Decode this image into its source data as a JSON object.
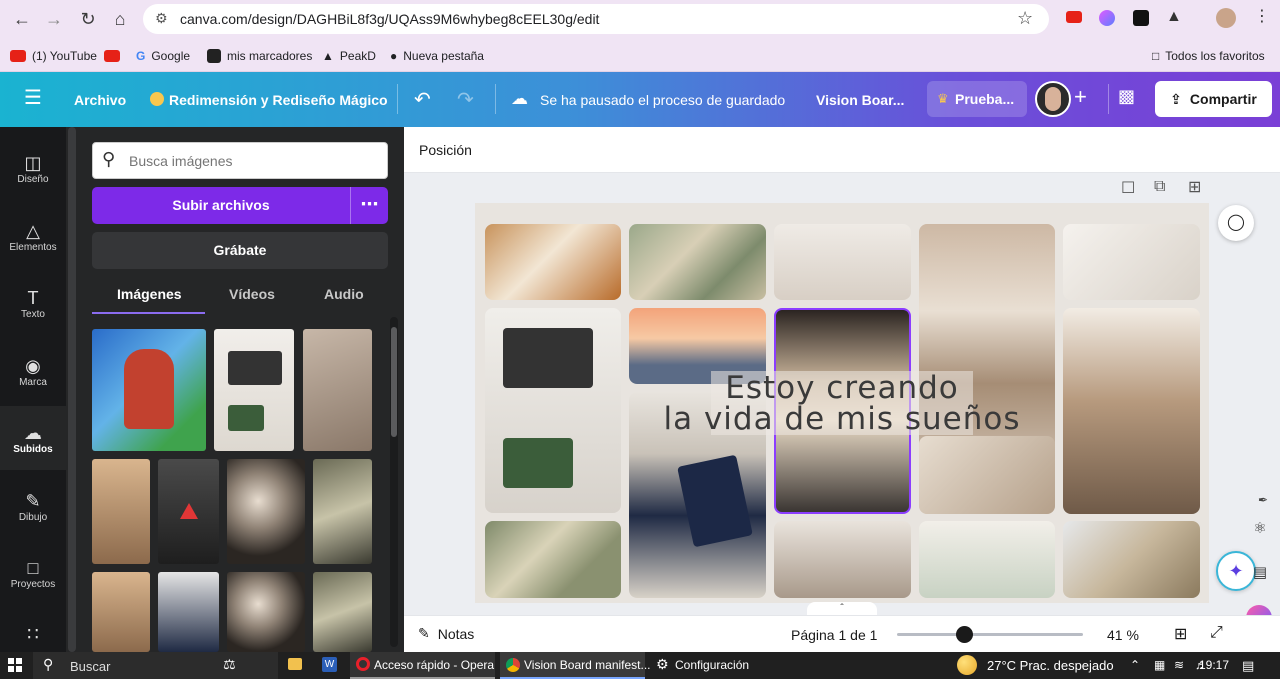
{
  "browser": {
    "url": "canva.com/design/DAGHBiL8f3g/UQAss9M6whybeg8cEEL30g/edit",
    "bookmarks": [
      "(1) YouTube",
      "Google",
      "mis marcadores",
      "PeakD",
      "Nueva pestaña"
    ],
    "all_favorites": "Todos los favoritos"
  },
  "header": {
    "archivo": "Archivo",
    "magic_resize": "Redimensión y Rediseño Mágico",
    "save_status": "Se ha pausado el proceso de guardado",
    "doc_title": "Vision Boar...",
    "trial": "Prueba...",
    "share": "Compartir"
  },
  "rail": {
    "items": [
      "Diseño",
      "Elementos",
      "Texto",
      "Marca",
      "Subidos",
      "Dibujo",
      "Proyectos"
    ]
  },
  "panel": {
    "search_placeholder": "Busca imágenes",
    "upload": "Subir archivos",
    "record": "Grábate",
    "tabs": [
      "Imágenes",
      "Vídeos",
      "Audio"
    ]
  },
  "workspace": {
    "position": "Posición",
    "overlay_line1": "Estoy creando",
    "overlay_line2": "la vida de mis sueños",
    "notes": "Notas",
    "page": "Página 1 de 1",
    "zoom": "41 %",
    "zoom_level": 0.36
  },
  "taskbar": {
    "search": "Buscar",
    "opera": "Acceso rápido - Opera",
    "chrome": "Vision Board manifest...",
    "settings": "Configuración",
    "weather": "27°C  Prac. despejado",
    "time": "19:17"
  },
  "colors": {
    "accent_purple": "#7d2ae8",
    "rail_bg": "#18191b",
    "panel_bg": "#252627"
  }
}
